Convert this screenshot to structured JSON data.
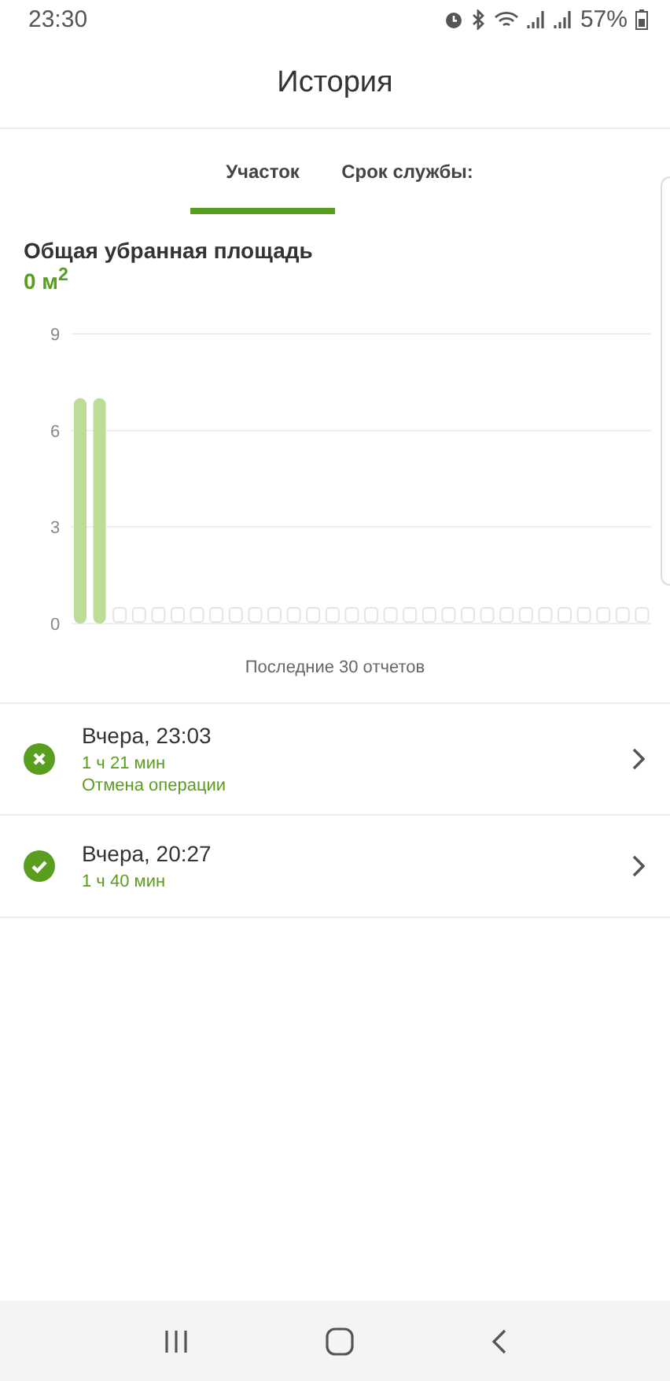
{
  "status_bar": {
    "time": "23:30",
    "battery": "57%"
  },
  "header": {
    "title": "История"
  },
  "tabs": [
    {
      "label": "Участок",
      "selected": true
    },
    {
      "label": "Срок службы:",
      "selected": false
    }
  ],
  "summary": {
    "title": "Общая убранная площадь",
    "value": "0 м$^{2}$"
  },
  "chart_data": {
    "type": "bar",
    "xlabel": "Последние 30 отчетов",
    "ylim": [
      0,
      9
    ],
    "yticks": [
      0,
      3,
      6,
      9
    ],
    "values": [
      7,
      7,
      0,
      0,
      0,
      0,
      0,
      0,
      0,
      0,
      0,
      0,
      0,
      0,
      0,
      0,
      0,
      0,
      0,
      0,
      0,
      0,
      0,
      0,
      0,
      0,
      0,
      0,
      0,
      0
    ]
  },
  "sessions": [
    {
      "kind": "cancelled",
      "time": "Вчера, 23:03",
      "duration": "1 ч 21 мин",
      "note": "Отмена операции"
    },
    {
      "kind": "completed",
      "time": "Вчера, 20:27",
      "duration": "1 ч 40 мин"
    }
  ]
}
